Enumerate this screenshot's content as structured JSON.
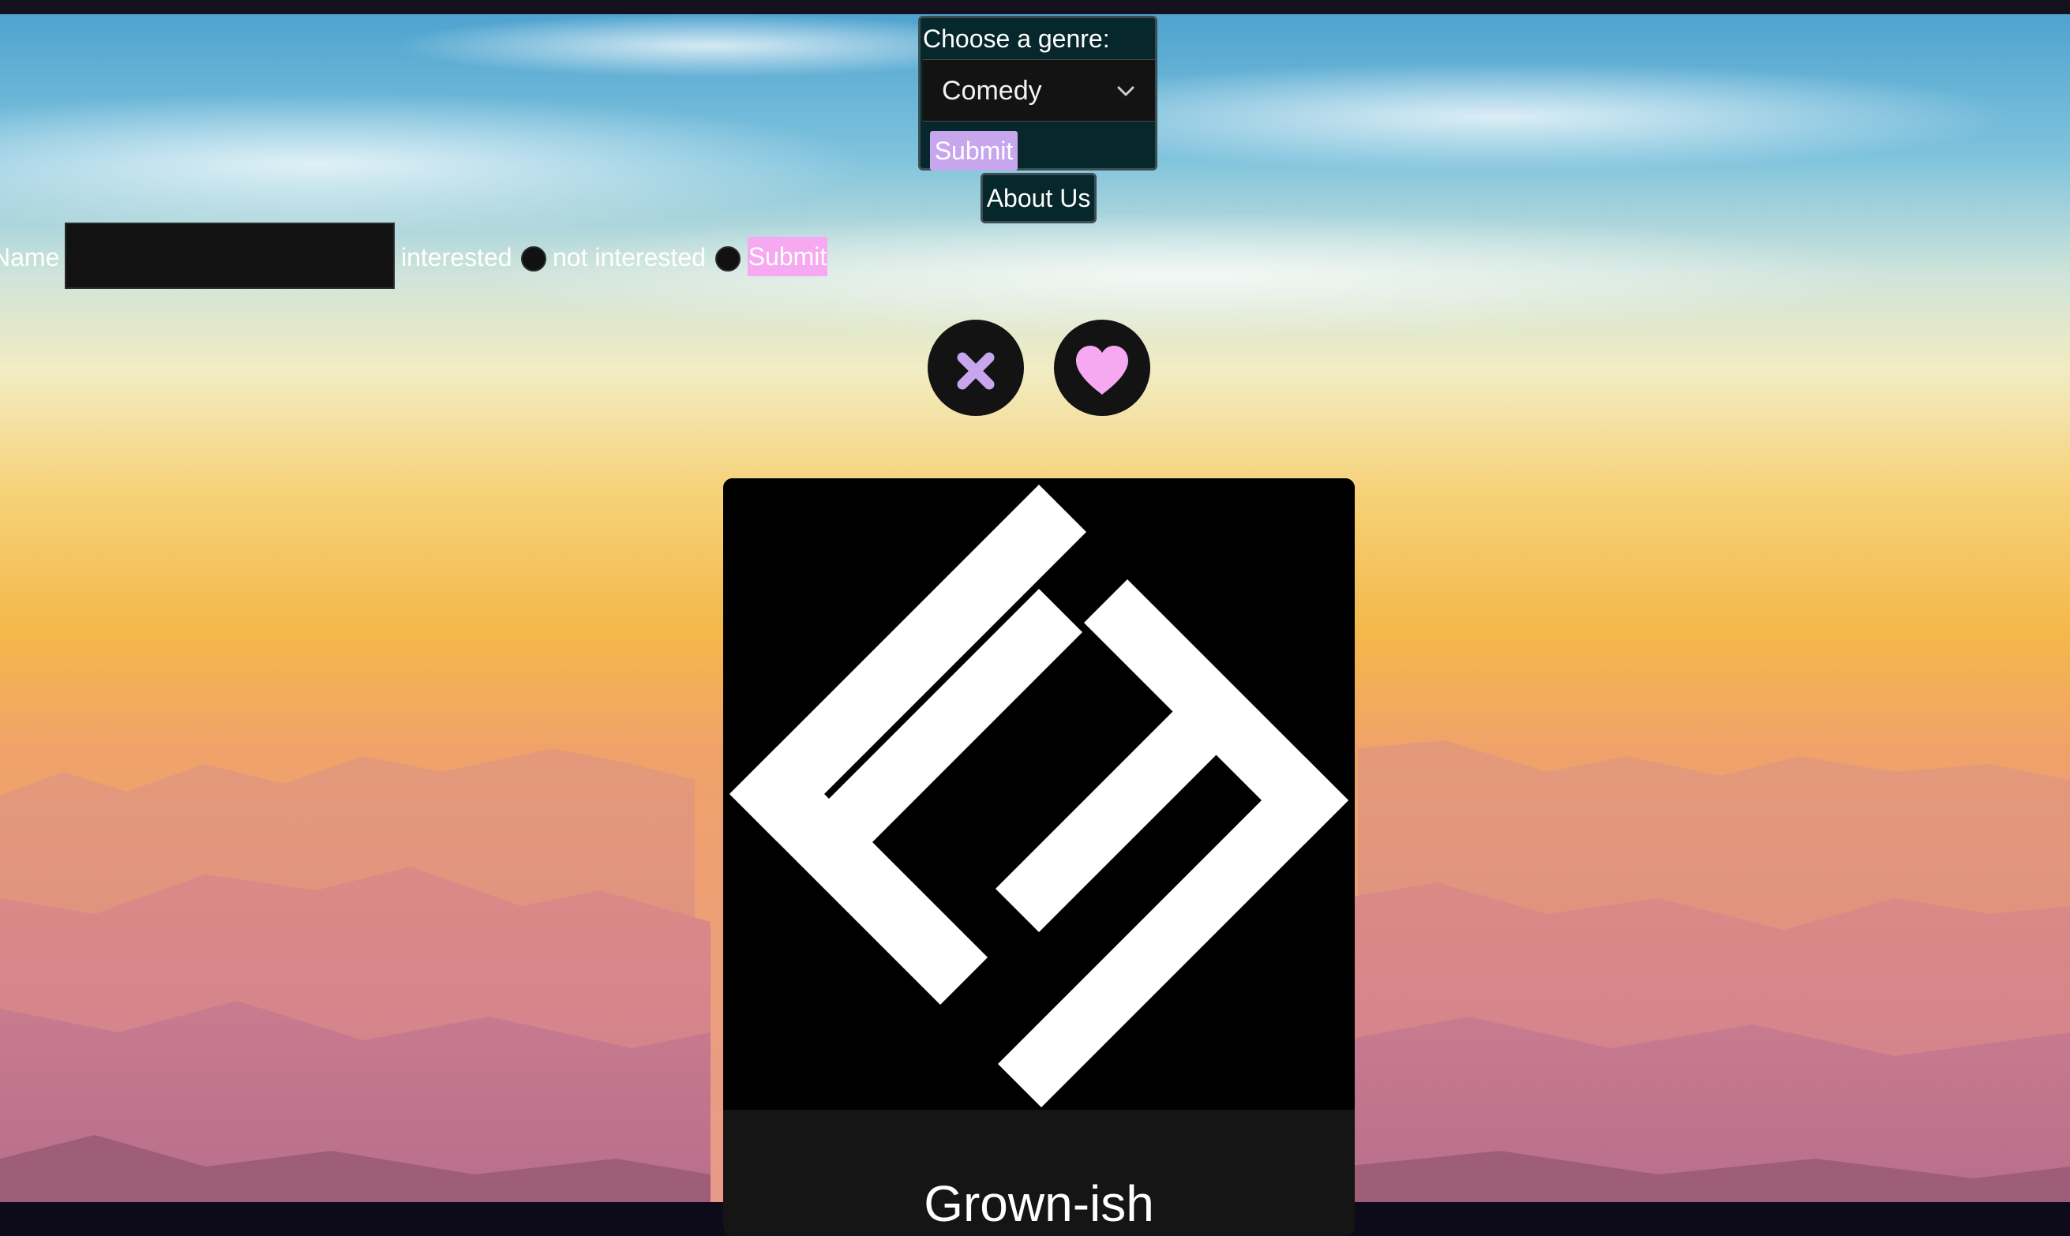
{
  "genre_form": {
    "label": "Choose a genre:",
    "selected": "Comedy",
    "submit_label": "Submit"
  },
  "about_label": "About Us",
  "name_form": {
    "name_label": "Name",
    "name_value": "",
    "option_interested": "interested",
    "option_not_interested": "not interested",
    "submit_label": "Submit"
  },
  "actions": {
    "dislike_icon": "x-icon",
    "like_icon": "heart-icon"
  },
  "card": {
    "title": "Grown-ish"
  },
  "colors": {
    "genre_submit": "#c7a6ee",
    "form_submit": "#f6a8f0",
    "panel_bg": "#06272b",
    "x_icon": "#c7a6ee",
    "heart_icon": "#f6a8f0"
  }
}
